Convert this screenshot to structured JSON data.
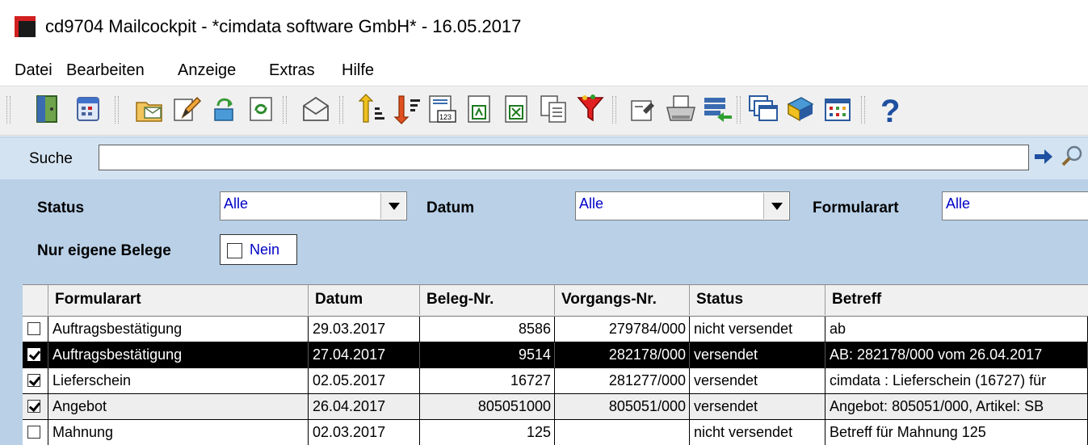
{
  "window": {
    "title": "cd9704 Mailcockpit - *cimdata software GmbH* - 16.05.2017"
  },
  "menu": [
    "Datei",
    "Bearbeiten",
    "Anzeige",
    "Extras",
    "Hilfe"
  ],
  "toolbar": {
    "icons": [
      "exit-icon",
      "calendar-icon",
      "open-mail-folder-icon",
      "edit-icon",
      "recycle-icon",
      "refresh-icon",
      "envelope-icon",
      "sort-ascending-icon",
      "sort-descending-icon",
      "number-list-icon",
      "export-pdf-icon",
      "export-excel-icon",
      "copy-documents-icon",
      "filter-icon",
      "properties-icon",
      "print-icon",
      "transfer-icon",
      "windows-icon",
      "book-icon",
      "table-icon",
      "help-icon"
    ]
  },
  "search": {
    "label": "Suche",
    "value": ""
  },
  "filters": {
    "status": {
      "label": "Status",
      "value": "Alle"
    },
    "datum": {
      "label": "Datum",
      "value": "Alle"
    },
    "formularart": {
      "label": "Formularart",
      "value": "Alle"
    },
    "nur_eigene": {
      "label": "Nur eigene Belege",
      "value": "Nein"
    }
  },
  "colors": {
    "accent_panel": "#b9d0e7",
    "search_bar": "#d4e3f1",
    "combo_text": "#0000c8"
  },
  "grid": {
    "columns": [
      "Formularart",
      "Datum",
      "Beleg-Nr.",
      "Vorgangs-Nr.",
      "Status",
      "Betreff"
    ],
    "rows": [
      {
        "checked": false,
        "formularart": "Auftragsbestätigung",
        "datum": "29.03.2017",
        "beleg": "8586",
        "vorgang": "279784/000",
        "status": "nicht versendet",
        "betreff": "ab"
      },
      {
        "checked": true,
        "selected": true,
        "formularart": "Auftragsbestätigung",
        "datum": "27.04.2017",
        "beleg": "9514",
        "vorgang": "282178/000",
        "status": "versendet",
        "betreff": "AB: 282178/000 vom 26.04.2017"
      },
      {
        "checked": true,
        "formularart": "Lieferschein",
        "datum": "02.05.2017",
        "beleg": "16727",
        "vorgang": "281277/000",
        "status": "versendet",
        "betreff": "cimdata : Lieferschein (16727) für"
      },
      {
        "checked": true,
        "formularart": "Angebot",
        "datum": "26.04.2017",
        "beleg": "805051000",
        "vorgang": "805051/000",
        "status": "versendet",
        "betreff": "Angebot: 805051/000, Artikel: SB"
      },
      {
        "checked": false,
        "formularart": "Mahnung",
        "datum": "02.03.2017",
        "beleg": "125",
        "vorgang": "",
        "status": "nicht versendet",
        "betreff": "Betreff für Mahnung 125"
      }
    ]
  }
}
